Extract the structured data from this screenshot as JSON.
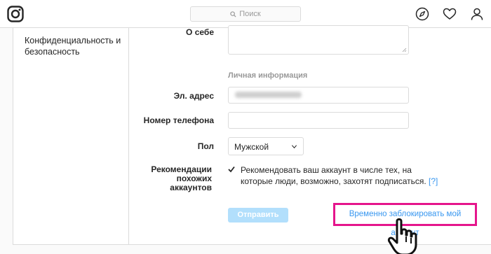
{
  "header": {
    "logo_icon": "instagram-icon",
    "search_placeholder": "Поиск",
    "nav_icons": [
      "compass-icon",
      "heart-icon",
      "profile-icon"
    ]
  },
  "sidebar": {
    "items": [
      {
        "label": "Конфиденциальность и безопасность"
      }
    ]
  },
  "form": {
    "bio_label": "О себе",
    "personal_info_title": "Личная информация",
    "email_label": "Эл. адрес",
    "phone_label": "Номер телефона",
    "gender_label": "Пол",
    "gender_value": "Мужской",
    "recommendations_label": "Рекомендации похожих аккаунтов",
    "recommendations_text": "Рекомендовать ваш аккаунт в числе тех, на которые люди, возможно, захотят подписаться.",
    "recommendations_help": "[?]",
    "recommendations_checked": true,
    "submit_label": "Отправить",
    "disable_account_link": "Временно заблокировать мой аккаунт"
  },
  "colors": {
    "link": "#3897f0",
    "highlight_border": "#e5158c",
    "submit_disabled": "#b2dffc"
  }
}
